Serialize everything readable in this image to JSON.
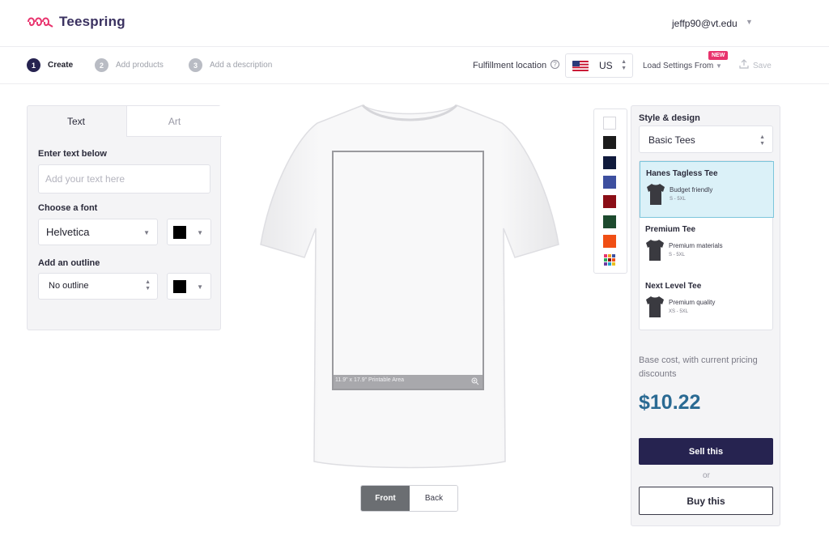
{
  "header": {
    "brand": "Teespring",
    "user_email": "jeffp90@vt.edu"
  },
  "steps": [
    {
      "number": "1",
      "label": "Create"
    },
    {
      "number": "2",
      "label": "Add products"
    },
    {
      "number": "3",
      "label": "Add a description"
    }
  ],
  "toolbar": {
    "fulfillment_label": "Fulfillment location",
    "country": "US",
    "load_settings": "Load Settings From",
    "new_badge": "NEW",
    "save_label": "Save"
  },
  "left_panel": {
    "tabs": [
      "Text",
      "Art"
    ],
    "enter_text_label": "Enter text below",
    "text_placeholder": "Add your text here",
    "font_label": "Choose a font",
    "font_value": "Helvetica",
    "outline_label": "Add an outline",
    "outline_value": "No outline",
    "font_color": "#000000",
    "outline_color": "#000000"
  },
  "canvas": {
    "print_area_label": "11.9\" x 17.9\" Printable Area",
    "sides": [
      "Front",
      "Back"
    ]
  },
  "swatches": [
    "#ffffff",
    "#1b1b1b",
    "#101a3c",
    "#3d4f9f",
    "#8b0e16",
    "#1d4a2e",
    "#f04e14",
    "multicolor"
  ],
  "right_panel": {
    "title": "Style & design",
    "style_value": "Basic Tees",
    "products": [
      {
        "name": "Hanes Tagless Tee",
        "desc": "Budget friendly",
        "sizes": "S - 5XL"
      },
      {
        "name": "Premium Tee",
        "desc": "Premium materials",
        "sizes": "S - 5XL"
      },
      {
        "name": "Next Level Tee",
        "desc": "Premium quality",
        "sizes": "XS - 5XL"
      }
    ],
    "base_cost_label": "Base cost, with current pricing discounts",
    "price": "$10.22",
    "sell_label": "Sell this",
    "or_label": "or",
    "buy_label": "Buy this"
  },
  "colors": {
    "brand": "#3a3160",
    "primary_button": "#262350",
    "price": "#2a6a93",
    "selected_product": "#dbf1f8",
    "new_badge": "#e8336d"
  }
}
